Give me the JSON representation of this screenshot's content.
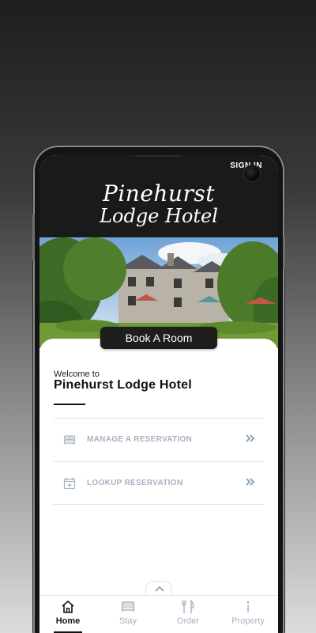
{
  "header": {
    "sign_in_label": "SIGN IN",
    "logo_line1": "Pinehurst",
    "logo_line2": "Lodge Hotel"
  },
  "hero": {
    "book_button_label": "Book A Room"
  },
  "welcome": {
    "small": "Welcome to",
    "title": "Pinehurst Lodge Hotel"
  },
  "menu": {
    "items": [
      {
        "label": "MANAGE A RESERVATION",
        "icon": "bed-icon"
      },
      {
        "label": "LOOKUP RESERVATION",
        "icon": "calendar-add-icon"
      }
    ]
  },
  "tabs": [
    {
      "label": "Home",
      "icon": "home-icon",
      "active": true
    },
    {
      "label": "Stay",
      "icon": "bed-icon"
    },
    {
      "label": "Order",
      "icon": "utensils-icon"
    },
    {
      "label": "Property",
      "icon": "info-icon"
    }
  ],
  "colors": {
    "accent_dark": "#1f1e1e",
    "muted_label": "#a6b2bf"
  }
}
